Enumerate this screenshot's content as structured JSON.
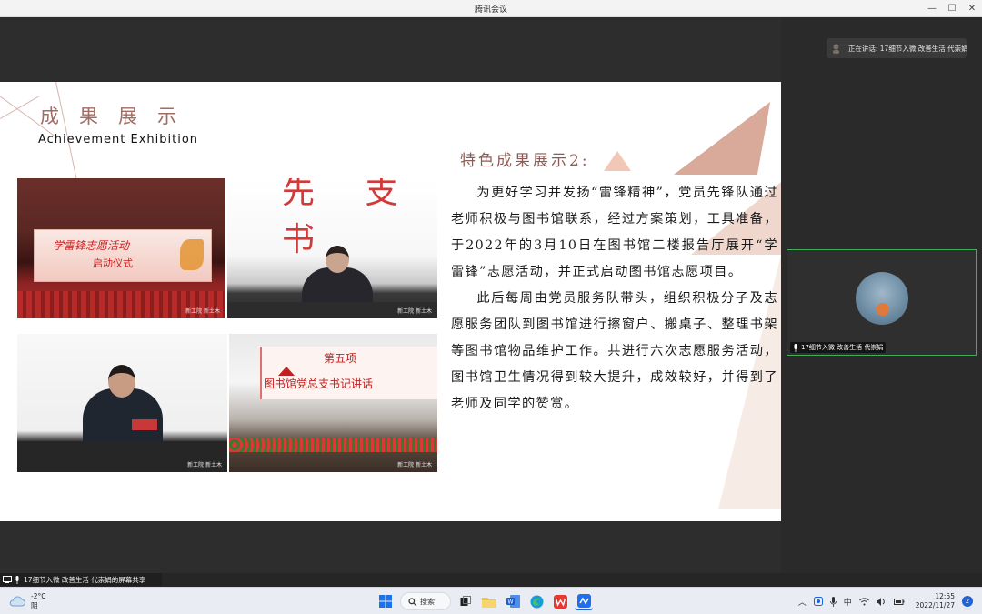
{
  "window": {
    "title": "腾讯会议",
    "minimize": "—",
    "maximize": "☐",
    "close": "✕"
  },
  "slide": {
    "title_cn": "成果展示",
    "title_en": "Achievement Exhibition",
    "heading": "特色成果展示2:",
    "paragraphs": [
      "为更好学习并发扬“雷锋精神”，党员先锋队通过老师积极与图书馆联系，经过方案策划，工具准备，于2022年的3月10日在图书馆二楼报告厅展开“学雷锋”志愿活动，并正式启动图书馆志愿项目。",
      "此后每周由党员服务队带头，组织积极分子及志愿服务团队到图书馆进行擦窗户、搬桌子、整理书架等图书馆物品维护工作。共进行六次志愿服务活动，图书馆卫生情况得到较大提升，成效较好，并得到了老师及同学的赞赏。"
    ],
    "photos": {
      "p1_banner_line1": "学雷锋志愿活动",
      "p1_banner_line2": "启动仪式",
      "p4_banner_line1": "第五项",
      "p4_banner_line2": "图书馆党总支书记讲话",
      "watermark": "新工院 新土木"
    }
  },
  "panel": {
    "speaking": "正在讲话: 17细节入微 改善生活 代崇娟",
    "tile_label": "17细节入微 改善生活 代崇娟"
  },
  "share_bar": {
    "text": "17细节入微 改善生活 代崇娟的屏幕共享"
  },
  "taskbar": {
    "temp": "-2°C",
    "condition": "阴",
    "search": "搜索",
    "ime": "中",
    "time": "12:55",
    "date": "2022/11/27",
    "notifications": "2"
  }
}
